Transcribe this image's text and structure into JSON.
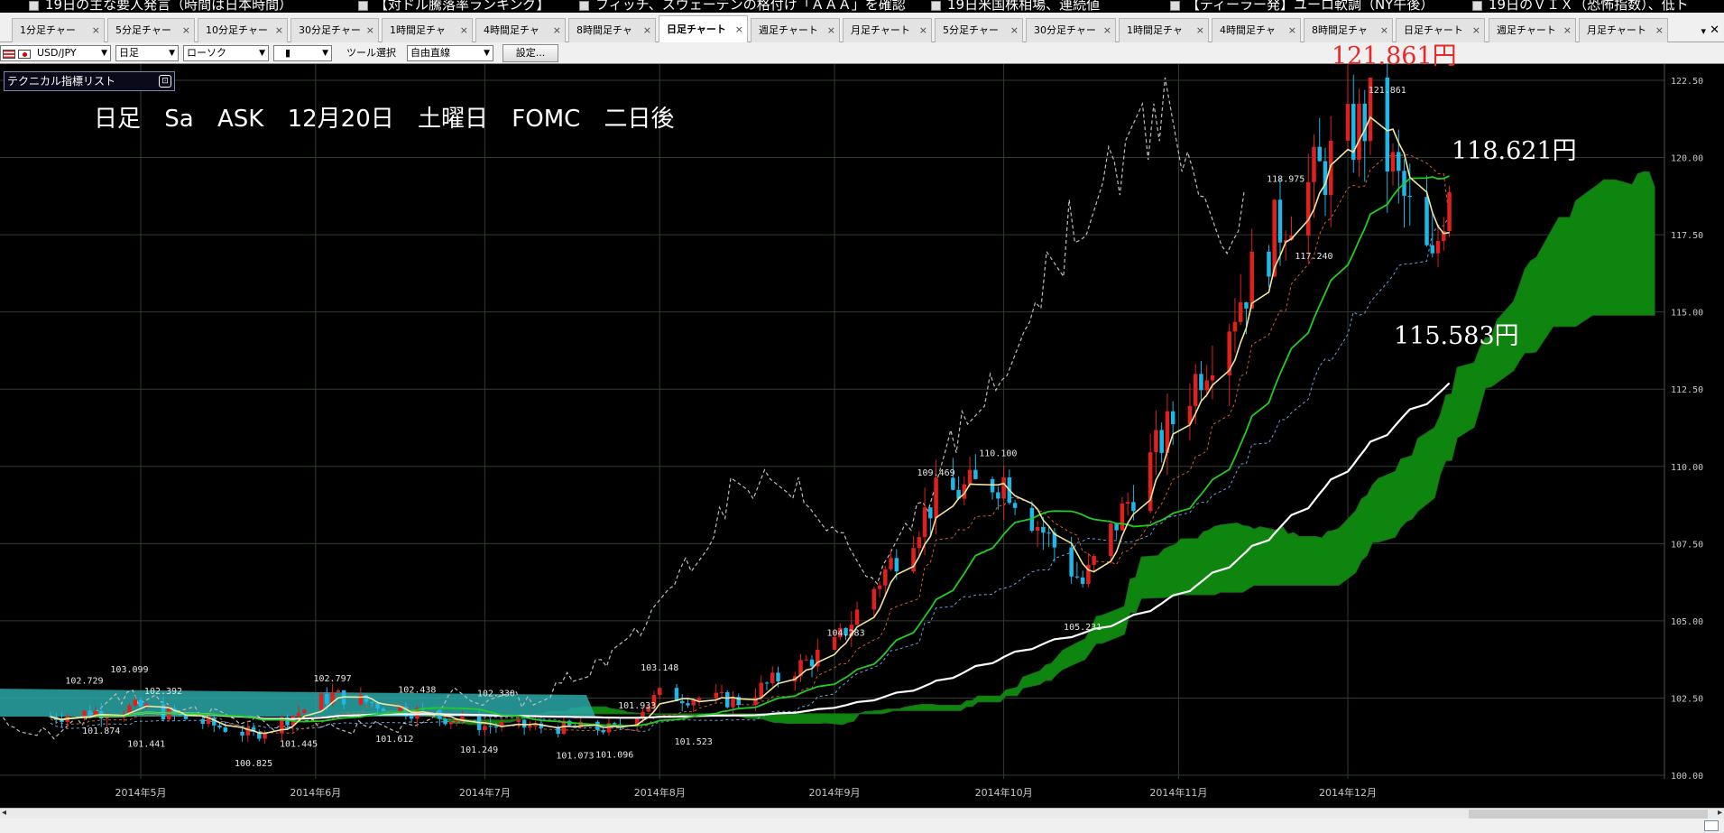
{
  "ticker": {
    "items": [
      "19日の主な要人発言（時間は日本時間）",
      "【対ドル騰落率ランキング】",
      "フィッチ、スウェーデンの格付け「ＡＡＡ」を確認",
      "19日米国株相場、連続値",
      "【ディーラー発】ユーロ軟調（NY午後）",
      "19日のＶＩＸ（恐怖指数）、低ト"
    ]
  },
  "tabs": [
    {
      "label": "1分足チャー",
      "active": false
    },
    {
      "label": "5分足チャー",
      "active": false
    },
    {
      "label": "10分足チャー",
      "active": false
    },
    {
      "label": "30分足チャー",
      "active": false
    },
    {
      "label": "1時間足チャ",
      "active": false
    },
    {
      "label": "4時間足チャ",
      "active": false
    },
    {
      "label": "8時間足チャ",
      "active": false
    },
    {
      "label": "日足チャート",
      "active": true
    },
    {
      "label": "週足チャート",
      "active": false
    },
    {
      "label": "月足チャート",
      "active": false
    },
    {
      "label": "5分足チャー",
      "active": false
    },
    {
      "label": "30分足チャー",
      "active": false
    },
    {
      "label": "1時間足チャ",
      "active": false
    },
    {
      "label": "4時間足チャ",
      "active": false
    },
    {
      "label": "8時間足チャ",
      "active": false
    },
    {
      "label": "日足チャート",
      "active": false
    },
    {
      "label": "週足チャート",
      "active": false
    },
    {
      "label": "月足チャート",
      "active": false
    }
  ],
  "tab_close_glyph": "×",
  "toolbar": {
    "pair": "USD/JPY",
    "timeframe": "日足",
    "chart_type": "ローソク",
    "marker": "▮",
    "tool_label": "ツール選択",
    "tool_value": "自由直線",
    "settings_label": "設定..."
  },
  "indicator_list": {
    "label": "テクニカル指標リスト"
  },
  "annotations": {
    "main": "日足 Sa ASK 12月20日 土曜日 FOMC 二日後",
    "peak_red": "121.861円",
    "price_118": "118.621円",
    "price_115": "115.583円"
  },
  "colors": {
    "bull": "#e0201e",
    "bear": "#1fb6e8",
    "ma_fast": "#f0e6a0",
    "ma_mid": "#22cc22",
    "ma_slow": "#ffffff",
    "cloud_up": "#0f8c0f",
    "cloud_down": "#2aa6a6",
    "grid": "#2e3d2e"
  },
  "chart_data": {
    "type": "candlestick",
    "ylim": [
      100.0,
      122.5
    ],
    "y_ticks": [
      "122.50",
      "120.00",
      "117.50",
      "115.00",
      "112.50",
      "110.00",
      "107.50",
      "105.00",
      "102.50",
      "100.00"
    ],
    "x_ticks": [
      "2014年5月",
      "2014年6月",
      "2014年7月",
      "2014年8月",
      "2014年9月",
      "2014年10月",
      "2014年11月",
      "2014年12月"
    ],
    "price_labels": [
      {
        "text": "103.099",
        "x": "2014-04-29",
        "y": 103.1
      },
      {
        "text": "102.729",
        "x": "2014-04-21",
        "y": 102.73
      },
      {
        "text": "101.874",
        "x": "2014-04-24",
        "y": 101.87
      },
      {
        "text": "102.392",
        "x": "2014-05-05",
        "y": 102.39
      },
      {
        "text": "101.441",
        "x": "2014-05-02",
        "y": 101.44
      },
      {
        "text": "100.825",
        "x": "2014-05-21",
        "y": 100.82
      },
      {
        "text": "101.445",
        "x": "2014-05-29",
        "y": 101.45
      },
      {
        "text": "102.797",
        "x": "2014-06-04",
        "y": 102.8
      },
      {
        "text": "102.438",
        "x": "2014-06-19",
        "y": 102.44
      },
      {
        "text": "101.612",
        "x": "2014-06-15",
        "y": 101.61
      },
      {
        "text": "102.330",
        "x": "2014-07-03",
        "y": 102.33
      },
      {
        "text": "101.249",
        "x": "2014-06-30",
        "y": 101.25
      },
      {
        "text": "101.073",
        "x": "2014-07-17",
        "y": 101.07
      },
      {
        "text": "101.933",
        "x": "2014-07-28",
        "y": 101.93
      },
      {
        "text": "101.096",
        "x": "2014-07-24",
        "y": 101.1
      },
      {
        "text": "103.148",
        "x": "2014-08-01",
        "y": 103.15
      },
      {
        "text": "101.523",
        "x": "2014-08-07",
        "y": 101.52
      },
      {
        "text": "104.283",
        "x": "2014-09-03",
        "y": 104.28
      },
      {
        "text": "109.469",
        "x": "2014-09-19",
        "y": 109.47
      },
      {
        "text": "110.100",
        "x": "2014-09-30",
        "y": 110.1
      },
      {
        "text": "105.231",
        "x": "2014-10-15",
        "y": 105.23
      },
      {
        "text": "118.975",
        "x": "2014-11-20",
        "y": 118.98
      },
      {
        "text": "117.240",
        "x": "2014-11-25",
        "y": 117.24
      },
      {
        "text": "121.861",
        "x": "2014-12-08",
        "y": 121.86
      }
    ],
    "closes_key": [
      [
        "2014-04-15",
        101.9
      ],
      [
        "2014-05-01",
        102.2
      ],
      [
        "2014-05-21",
        101.3
      ],
      [
        "2014-06-04",
        102.6
      ],
      [
        "2014-07-01",
        101.6
      ],
      [
        "2014-07-24",
        101.5
      ],
      [
        "2014-08-01",
        102.6
      ],
      [
        "2014-08-15",
        102.4
      ],
      [
        "2014-09-01",
        104.2
      ],
      [
        "2014-09-19",
        109.0
      ],
      [
        "2014-10-01",
        109.6
      ],
      [
        "2014-10-15",
        106.2
      ],
      [
        "2014-10-31",
        111.5
      ],
      [
        "2014-11-20",
        118.2
      ],
      [
        "2014-12-05",
        121.4
      ],
      [
        "2014-12-16",
        116.3
      ],
      [
        "2014-12-19",
        119.5
      ]
    ]
  }
}
